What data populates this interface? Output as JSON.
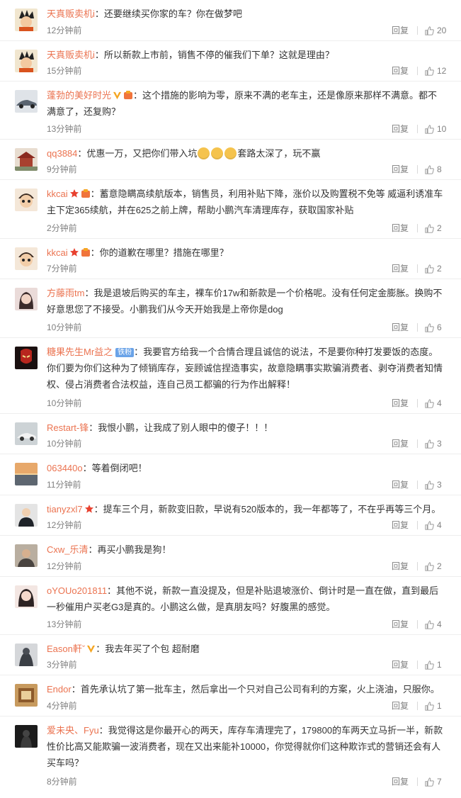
{
  "labels": {
    "reply": "回复"
  },
  "comments": [
    {
      "user": "天真贩卖机i",
      "text": "还要继续买你家的车？你在做梦吧",
      "time": "12分钟前",
      "likes": "20",
      "avatar": "goku",
      "avatar_color": "#c0582e"
    },
    {
      "user": "天真贩卖机i",
      "text": "所以新款上市前，销售不停的催我们下单？这就是理由？",
      "time": "15分钟前",
      "likes": "12",
      "avatar": "goku",
      "avatar_color": "#c0582e"
    },
    {
      "user": "蓬勃的美好时光",
      "text": "这个措施的影响为零，原来不满的老车主，还是像原来那样不满意。都不满意了，还复购？",
      "time": "13分钟前",
      "likes": "10",
      "avatar": "car",
      "avatar_color": "#8d97a3",
      "vip": true,
      "badge": true
    },
    {
      "user": "qq3884",
      "text_parts": [
        "优惠一万，又把你们带入坑",
        "套路太深了，玩不赢"
      ],
      "emoji_count": 3,
      "time": "9分钟前",
      "likes": "8",
      "avatar": "temple",
      "avatar_color": "#9b3b2d"
    },
    {
      "user": "kkcai",
      "text": "蓄意隐瞒高续航版本，销售员，利用补贴下降，涨价以及购置税不免等 威逼利诱准车主下定365续航，并在625之前上牌，帮助小鹏汽车清理库存，获取国家补贴",
      "time": "2分钟前",
      "likes": "2",
      "avatar": "boy",
      "avatar_color": "#e7c8a6",
      "star": true,
      "badge": true
    },
    {
      "user": "kkcai",
      "text": "你的道歉在哪里？措施在哪里？",
      "time": "7分钟前",
      "likes": "2",
      "avatar": "boy",
      "avatar_color": "#e7c8a6",
      "star": true,
      "badge": true
    },
    {
      "user": "方藤雨tm",
      "text": "我是退坡后购买的车主，裸车价17w和新款是一个价格呢。没有任何定金膨胀。换购不好意思您了不接受。小鹏我们从今天开始我是上帝你是dog",
      "time": "10分钟前",
      "likes": "6",
      "avatar": "girl",
      "avatar_color": "#c98f93"
    },
    {
      "user": "糖果先生Mr益之",
      "tag": "铁粉",
      "text": "我要官方给我一个合情合理且诚信的说法，不是要你种打发要饭的态度。你们要为你们这种为了倾销库存，妄顾诚信捏造事实，故意隐瞒事实欺骗消费者、剥夺消费者知情权、侵占消费者合法权益，连自己员工都骗的行为作出解释！",
      "time": "10分钟前",
      "likes": "4",
      "avatar": "ironman",
      "avatar_color": "#7a1a16"
    },
    {
      "user": "Restart-锋",
      "text": "我恨小鹏，让我成了别人眼中的傻子！！！",
      "time": "10分钟前",
      "likes": "3",
      "avatar": "car2",
      "avatar_color": "#9aa6a8"
    },
    {
      "user": "063440o",
      "text": "等着倒闭吧！",
      "time": "11分钟前",
      "likes": "3",
      "avatar": "sunset",
      "avatar_color": "#c4884f"
    },
    {
      "user": "tianyzxl7",
      "text": "提车三个月，新款变旧款，早说有520版本的，我一年都等了，不在乎再等三个月。",
      "time": "12分钟前",
      "likes": "4",
      "avatar": "suit",
      "avatar_color": "#333840",
      "star": true
    },
    {
      "user": "Cxw_乐清",
      "text": "再买小鹏我是狗！",
      "time": "12分钟前",
      "likes": "2",
      "avatar": "man",
      "avatar_color": "#6b6258"
    },
    {
      "user": "oYOUo201811",
      "text": "其他不说，新款一直没提及，但是补贴退坡涨价、倒计时是一直在做，直到最后一秒催用户买老G3是真的。小鹏这么做，是真朋友吗？好腹黑的感觉。",
      "time": "13分钟前",
      "likes": "4",
      "avatar": "girl2",
      "avatar_color": "#d9b3a8"
    },
    {
      "user": "Eason軒ˇ",
      "text": "我去年买了个包 超耐磨",
      "time": "3分钟前",
      "likes": "1",
      "avatar": "dark",
      "avatar_color": "#5b5f66",
      "vip": true
    },
    {
      "user": "Endor",
      "text": "首先承认坑了第一批车主，然后拿出一个只对自己公司有利的方案，火上浇油，只服你。",
      "time": "4分钟前",
      "likes": "1",
      "avatar": "room",
      "avatar_color": "#a0703a"
    },
    {
      "user": "爱未央、Fyu",
      "text": "我觉得这是你最开心的两天，库存车清理完了，179800的车两天立马折一半，新款性价比高又能欺骗一波消费者，现在又出来能补10000，你觉得就你们这种欺诈式的营销还会有人买车吗？",
      "time": "8分钟前",
      "likes": "7",
      "avatar": "silhouette",
      "avatar_color": "#2a2a2a"
    }
  ]
}
